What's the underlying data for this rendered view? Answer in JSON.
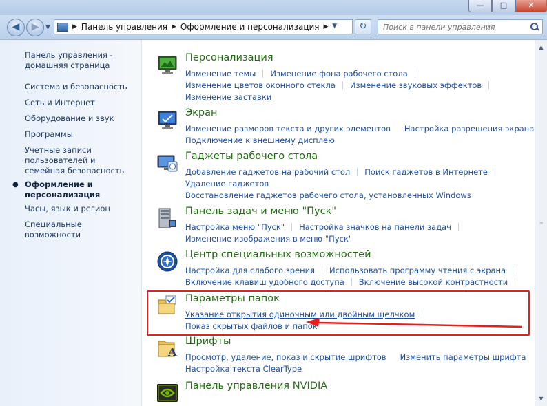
{
  "window": {
    "min_label": "—",
    "max_label": "□",
    "close_label": "✕"
  },
  "address": {
    "crumbs": [
      "Панель управления",
      "Оформление и персонализация"
    ],
    "search_placeholder": "Поиск в панели управления"
  },
  "sidebar": {
    "items": [
      {
        "label": "Панель управления - домашняя страница"
      },
      {
        "label": "Система и безопасность"
      },
      {
        "label": "Сеть и Интернет"
      },
      {
        "label": "Оборудование и звук"
      },
      {
        "label": "Программы"
      },
      {
        "label": "Учетные записи пользователей и семейная безопасность"
      },
      {
        "label": "Оформление и персонализация",
        "active": true
      },
      {
        "label": "Часы, язык и регион"
      },
      {
        "label": "Специальные возможности"
      }
    ]
  },
  "categories": [
    {
      "title": "Персонализация",
      "icon": "personalization-icon",
      "links": [
        [
          "Изменение темы",
          "Изменение фона рабочего стола"
        ],
        [
          "Изменение цветов оконного стекла",
          "Изменение звуковых эффектов"
        ],
        [
          "Изменение заставки"
        ]
      ]
    },
    {
      "title": "Экран",
      "icon": "display-icon",
      "links": [
        [
          "Изменение размеров текста и других элементов",
          "Настройка разрешения экрана"
        ],
        [
          "Подключение к внешнему дисплею"
        ]
      ]
    },
    {
      "title": "Гаджеты рабочего стола",
      "icon": "gadgets-icon",
      "links": [
        [
          "Добавление гаджетов на рабочий стол",
          "Поиск гаджетов в Интернете"
        ],
        [
          "Удаление гаджетов"
        ],
        [
          "Восстановление гаджетов рабочего стола, установленных Windows"
        ]
      ]
    },
    {
      "title": "Панель задач и меню \"Пуск\"",
      "icon": "taskbar-icon",
      "links": [
        [
          "Настройка меню \"Пуск\"",
          "Настройка значков на панели задач"
        ],
        [
          "Изменение изображения в меню \"Пуск\""
        ]
      ]
    },
    {
      "title": "Центр специальных возможностей",
      "icon": "accessibility-icon",
      "links": [
        [
          "Настройка для слабого зрения",
          "Использовать программу чтения с экрана"
        ],
        [
          "Включение клавиш удобного доступа",
          "Включение высокой контрастности"
        ]
      ]
    },
    {
      "title": "Параметры папок",
      "icon": "folder-options-icon",
      "links": [
        [
          "Указание открытия одиночным или двойным щелчком"
        ],
        [
          "Показ скрытых файлов и папок"
        ]
      ]
    },
    {
      "title": "Шрифты",
      "icon": "fonts-icon",
      "links": [
        [
          "Просмотр, удаление, показ и скрытие шрифтов",
          "Изменить параметры шрифта"
        ],
        [
          "Настройка текста ClearType"
        ]
      ]
    },
    {
      "title": "Панель управления NVIDIA",
      "icon": "nvidia-icon",
      "links": []
    }
  ],
  "annotation": {
    "color": "#e21e1e"
  }
}
